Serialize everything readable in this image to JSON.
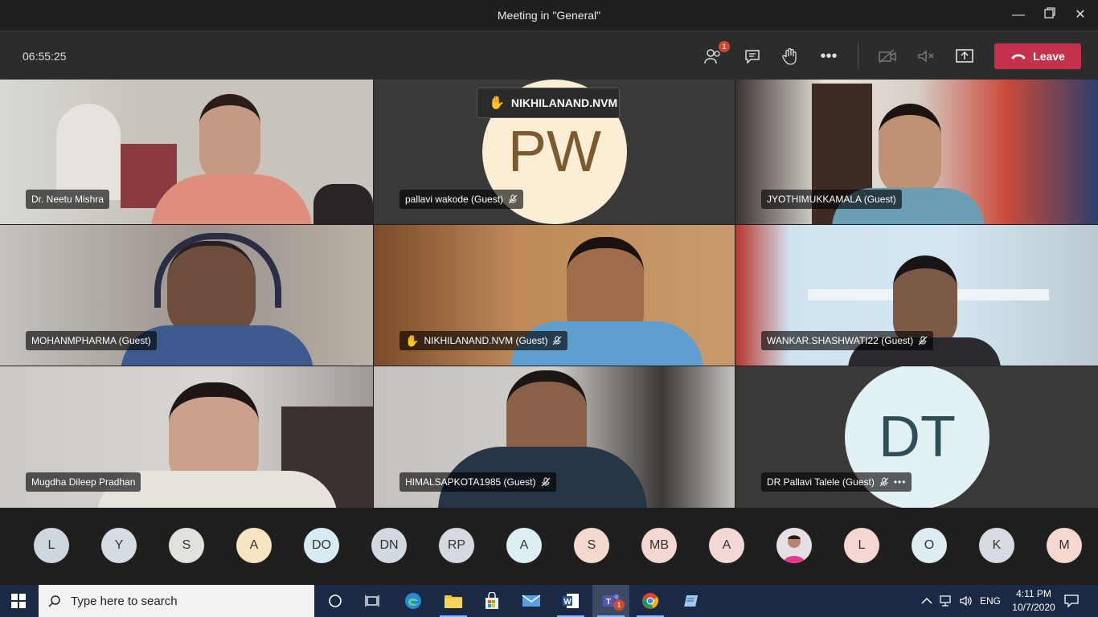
{
  "window": {
    "title": "Meeting in \"General\""
  },
  "toolbar": {
    "timer": "06:55:25",
    "participants_badge": "1",
    "leave_label": "Leave"
  },
  "raise_hand_popup": {
    "name": "NIKHILANAND.NVM"
  },
  "tiles": [
    {
      "name": "Dr. Neetu Mishra",
      "muted": false,
      "hand": false
    },
    {
      "name": "pallavi wakode (Guest)",
      "muted": true,
      "hand": false,
      "initials": "PW"
    },
    {
      "name": "JYOTHIMUKKAMALA (Guest)",
      "muted": false,
      "hand": false
    },
    {
      "name": "MOHANMPHARMA (Guest)",
      "muted": false,
      "hand": false
    },
    {
      "name": "NIKHILANAND.NVM (Guest)",
      "muted": true,
      "hand": true
    },
    {
      "name": "WANKAR.SHASHWATI22 (Guest)",
      "muted": true,
      "hand": false
    },
    {
      "name": "Mugdha Dileep Pradhan",
      "muted": false,
      "hand": false
    },
    {
      "name": "HIMALSAPKOTA1985 (Guest)",
      "muted": true,
      "hand": false
    },
    {
      "name": "DR Pallavi Talele (Guest)",
      "muted": true,
      "hand": false,
      "initials": "DT"
    }
  ],
  "roster": [
    {
      "initials": "L",
      "color": "#d0d6de"
    },
    {
      "initials": "Y",
      "color": "#d6dce4"
    },
    {
      "initials": "S",
      "color": "#e0e2dc"
    },
    {
      "initials": "A",
      "color": "#f8e5c2"
    },
    {
      "initials": "DO",
      "color": "#d7ebf3"
    },
    {
      "initials": "DN",
      "color": "#d3d9e1"
    },
    {
      "initials": "RP",
      "color": "#d6dae0"
    },
    {
      "initials": "A",
      "color": "#dcf0f2"
    },
    {
      "initials": "S",
      "color": "#f4d9cf"
    },
    {
      "initials": "MB",
      "color": "#f3d7d3"
    },
    {
      "initials": "A",
      "color": "#f2d8d4"
    },
    {
      "initials": "",
      "color": "#e3a6c4"
    },
    {
      "initials": "L",
      "color": "#f6d6d2"
    },
    {
      "initials": "O",
      "color": "#dcecf0"
    },
    {
      "initials": "K",
      "color": "#d7dbe2"
    },
    {
      "initials": "M",
      "color": "#f7d8d0"
    }
  ],
  "taskbar": {
    "search_placeholder": "Type here to search",
    "teams_badge": "1",
    "language": "ENG",
    "time": "4:11 PM",
    "date": "10/7/2020"
  }
}
